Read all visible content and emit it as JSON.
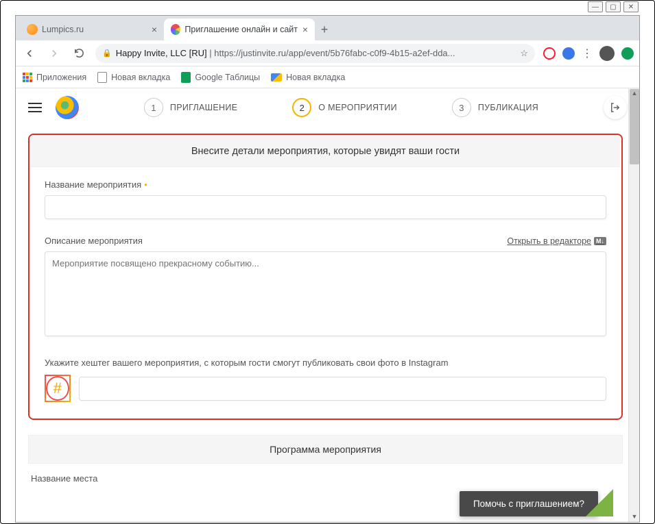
{
  "window": {
    "min": "—",
    "max": "▢",
    "close": "✕"
  },
  "tabs": {
    "left": "Lumpics.ru",
    "right": "Приглашение онлайн и сайт ме",
    "close": "×",
    "plus": "+"
  },
  "addressbar": {
    "host": "Happy Invite, LLC [RU]",
    "sep": " | ",
    "url": "https://justinvite.ru/app/event/5b76fabc-c0f9-4b15-a2ef-dda...",
    "star": "☆"
  },
  "bookmarks": {
    "apps": "Приложения",
    "new1": "Новая вкладка",
    "sheets": "Google Таблицы",
    "new2": "Новая вкладка"
  },
  "steps": {
    "s1": {
      "num": "1",
      "label": "ПРИГЛАШЕНИЕ"
    },
    "s2": {
      "num": "2",
      "label": "О МЕРОПРИЯТИИ"
    },
    "s3": {
      "num": "3",
      "label": "ПУБЛИКАЦИЯ"
    }
  },
  "form": {
    "header": "Внесите детали мероприятия, которые увидят ваши гости",
    "name_label": "Название мероприятия",
    "desc_label": "Описание мероприятия",
    "editor_link": "Открыть в редакторе",
    "md": "M↓",
    "desc_placeholder": "Мероприятие посвящено прекрасному событию...",
    "hashtag_label": "Укажите хештег вашего мероприятия, с которым гости смогут публиковать свои фото в Instagram",
    "hash": "#"
  },
  "program_header": "Программа мероприятия",
  "place_label": "Название места",
  "help": "Помочь с приглашением?"
}
